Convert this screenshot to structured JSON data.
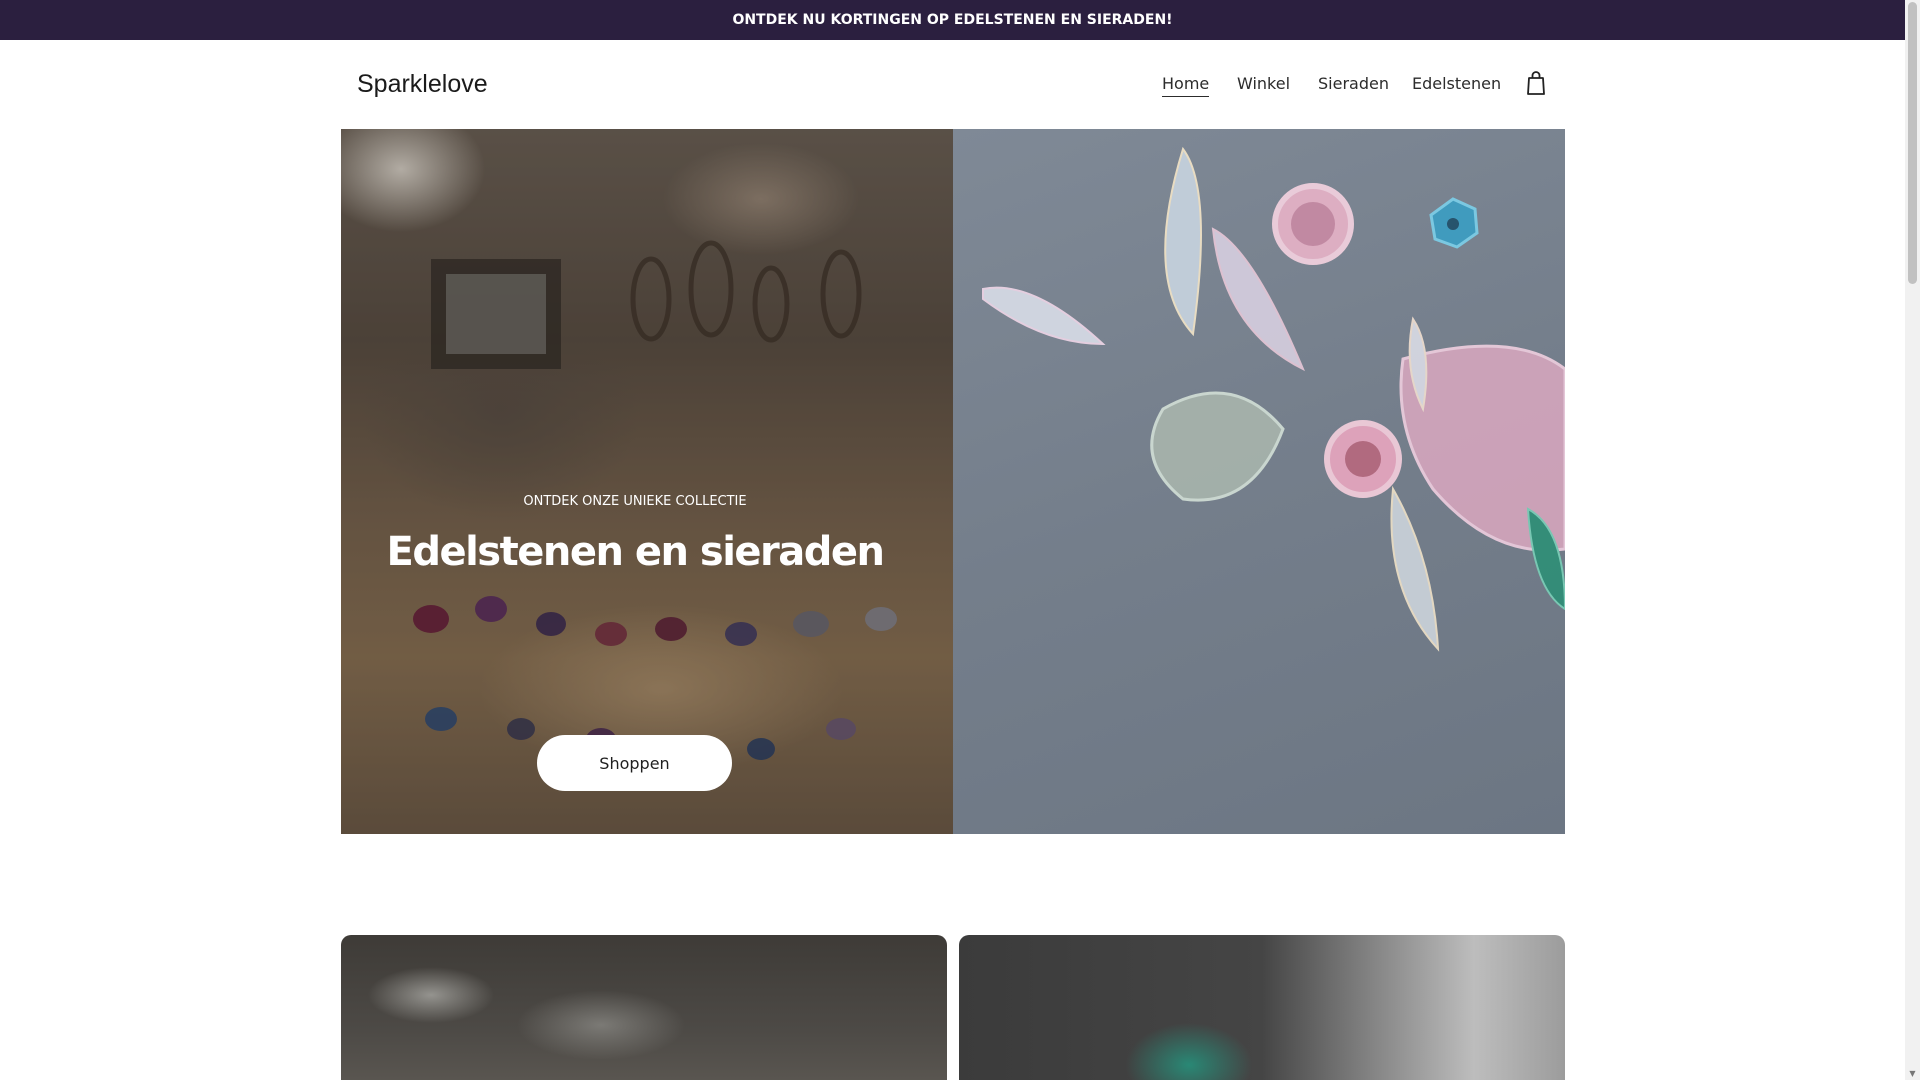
{
  "announcement": "ONTDEK NU KORTINGEN OP EDELSTENEN EN SIERADEN!",
  "header": {
    "logo": "Sparklelove",
    "nav": [
      {
        "label": "Home",
        "active": true
      },
      {
        "label": "Winkel",
        "active": false
      },
      {
        "label": "Sieraden",
        "active": false
      },
      {
        "label": "Edelstenen",
        "active": false
      }
    ],
    "cart_icon": "shopping-bag-icon"
  },
  "hero": {
    "eyebrow": "ONTDEK ONZE UNIEKE COLLECTIE",
    "title": "Edelstenen en sieraden",
    "button_label": "Shoppen"
  },
  "colors": {
    "announcement_bg": "#2b1f3f",
    "button_bg": "#ffffff"
  }
}
